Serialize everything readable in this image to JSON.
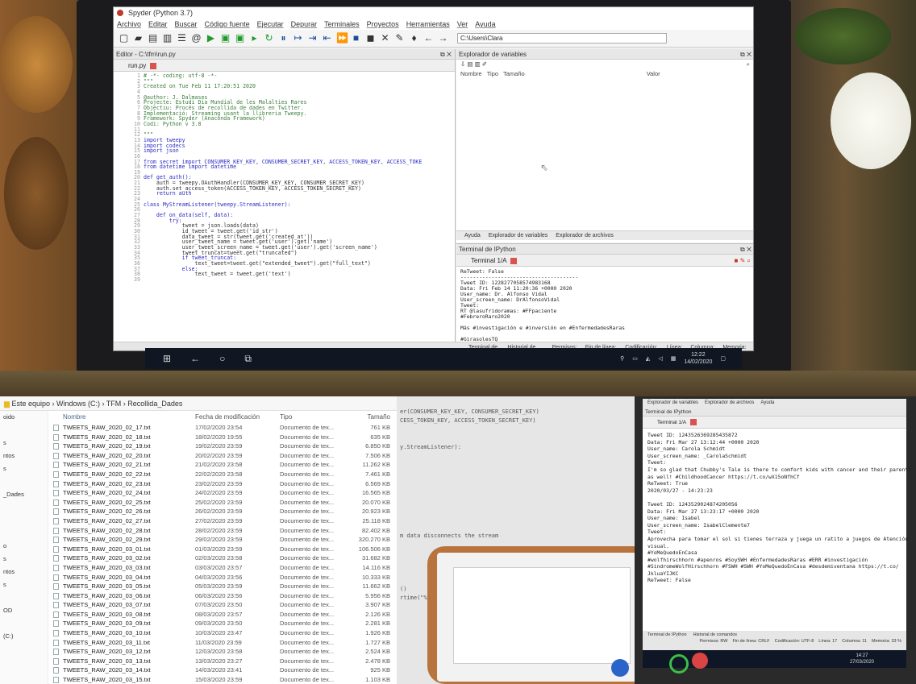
{
  "spyder": {
    "title": "Spyder (Python 3.7)",
    "menu": [
      "Archivo",
      "Editar",
      "Buscar",
      "Código fuente",
      "Ejecutar",
      "Depurar",
      "Terminales",
      "Proyectos",
      "Herramientas",
      "Ver",
      "Ayuda"
    ],
    "path": "C:\\Users\\Clara",
    "editor_header": "Editor - C:\\tfm\\run.py",
    "editor_tab": "run.py",
    "code_lines": [
      {
        "n": "1",
        "t": "# -*- coding: utf-8 -*-",
        "c": "cm"
      },
      {
        "n": "2",
        "t": "\"\"\"",
        "c": "cm"
      },
      {
        "n": "3",
        "t": "Created on Tue Feb 11 17:20:51 2020",
        "c": "cm"
      },
      {
        "n": "4",
        "t": "",
        "c": "cm"
      },
      {
        "n": "5",
        "t": "@author: J. Dalmases",
        "c": "cm"
      },
      {
        "n": "6",
        "t": "Projecte: Estudi Dia Mundial de les Malalties Rares",
        "c": "cm"
      },
      {
        "n": "7",
        "t": "Objectiu: Procés de recollida de dades en Twitter.",
        "c": "cm"
      },
      {
        "n": "8",
        "t": "Implementació: Streaming usant la llibreria Tweepy.",
        "c": "cm"
      },
      {
        "n": "9",
        "t": "Framework: Spyder (Anaconda Framework)",
        "c": "cm"
      },
      {
        "n": "10",
        "t": "Codi: Python v 3.8",
        "c": "cm"
      },
      {
        "n": "11",
        "t": "",
        "c": "cm"
      },
      {
        "n": "12",
        "t": "\"\"\"",
        "c": "cm"
      },
      {
        "n": "13",
        "t": "import tweepy",
        "c": "kw"
      },
      {
        "n": "14",
        "t": "import codecs",
        "c": "kw"
      },
      {
        "n": "15",
        "t": "import json",
        "c": "kw"
      },
      {
        "n": "16",
        "t": "",
        "c": "df"
      },
      {
        "n": "17",
        "t": "from secret import CONSUMER_KEY_KEY, CONSUMER_SECRET_KEY, ACCESS_TOKEN_KEY, ACCESS_TOKE",
        "c": "kw"
      },
      {
        "n": "18",
        "t": "from datetime import datetime",
        "c": "kw"
      },
      {
        "n": "19",
        "t": "",
        "c": "df"
      },
      {
        "n": "20",
        "t": "def get_auth():",
        "c": "kw"
      },
      {
        "n": "21",
        "t": "    auth = tweepy.OAuthHandler(CONSUMER_KEY_KEY, CONSUMER_SECRET_KEY)",
        "c": "df"
      },
      {
        "n": "22",
        "t": "    auth.set_access_token(ACCESS_TOKEN_KEY, ACCESS_TOKEN_SECRET_KEY)",
        "c": "df"
      },
      {
        "n": "23",
        "t": "    return auth",
        "c": "kw"
      },
      {
        "n": "24",
        "t": "",
        "c": "df"
      },
      {
        "n": "25",
        "t": "class MyStreamListener(tweepy.StreamListener):",
        "c": "kw"
      },
      {
        "n": "26",
        "t": "",
        "c": "df"
      },
      {
        "n": "27",
        "t": "    def on_data(self, data):",
        "c": "kw"
      },
      {
        "n": "28",
        "t": "        try:",
        "c": "kw"
      },
      {
        "n": "29",
        "t": "            tweet = json.loads(data)",
        "c": "df"
      },
      {
        "n": "30",
        "t": "            id_tweet = tweet.get('id_str')",
        "c": "df"
      },
      {
        "n": "31",
        "t": "            data_tweet = str(tweet.get('created_at'))",
        "c": "df"
      },
      {
        "n": "32",
        "t": "            user_tweet_name = tweet.get('user').get('name')",
        "c": "df"
      },
      {
        "n": "33",
        "t": "            user_tweet_screen_name = tweet.get('user').get('screen_name')",
        "c": "df"
      },
      {
        "n": "34",
        "t": "            tweet_truncat=tweet.get(\"truncated\")",
        "c": "df"
      },
      {
        "n": "35",
        "t": "            if tweet_truncat:",
        "c": "kw"
      },
      {
        "n": "36",
        "t": "                text_tweet=tweet.get(\"extended_tweet\").get(\"full_text\")",
        "c": "df"
      },
      {
        "n": "37",
        "t": "            else:",
        "c": "kw"
      },
      {
        "n": "38",
        "t": "                text_tweet = tweet.get('text')",
        "c": "df"
      },
      {
        "n": "39",
        "t": "",
        "c": "df"
      }
    ],
    "varexp_header": "Explorador de variables",
    "varexp_cols": [
      "Nombre",
      "Tipo",
      "Tamaño",
      "Valor"
    ],
    "varexp_tabs": [
      "Ayuda",
      "Explorador de variables",
      "Explorador de archivos"
    ],
    "console_header": "Terminal de IPython",
    "console_tab": "Terminal 1/A",
    "console_text": "ReTweet: False\n--------------------------------------\nTweet ID: 1228277058574983168\nData: Fri Feb 14 11:20:36 +0000 2020\nUser_name: Dr. Alfonso Vidal\nUser_screen_name: DrAlfonsoVidal\nTweet:\nRT @lasufridoramas: #FFpaciente\n#FebreroRaro2020\n\nMás #investigación e #inversión en #EnfermedadesRaras\n\n#GirasolesTQ\n#QuistosTarlov https:…\nReTweet: True",
    "console_tabs": [
      "Terminal de IPython",
      "Historial de comandos"
    ],
    "status": [
      "Permisos: RW",
      "Fin de línea: CRLF",
      "Codificación: UTF-8",
      "Línea: 1",
      "Columna: 1",
      "Memoria: 62 %"
    ],
    "clock": "12:22",
    "date": "14/02/2020"
  },
  "explorer": {
    "breadcrumb": "Este equipo  ›  Windows (C:)  ›  TFM  ›  Recollida_Dades",
    "side_items": [
      "oido",
      "",
      "s",
      "ntos",
      "s",
      "",
      "_Dades",
      "",
      "",
      "",
      "o",
      "s",
      "ntos",
      "s",
      "",
      "OD",
      "",
      "(C:)"
    ],
    "columns": [
      "Nombre",
      "Fecha de modificación",
      "Tipo",
      "Tamaño"
    ],
    "rows": [
      [
        "TWEETS_RAW_2020_02_17.txt",
        "17/02/2020 23:54",
        "Documento de tex...",
        "761 KB"
      ],
      [
        "TWEETS_RAW_2020_02_18.txt",
        "18/02/2020 19:55",
        "Documento de tex...",
        "635 KB"
      ],
      [
        "TWEETS_RAW_2020_02_19.txt",
        "19/02/2020 23:59",
        "Documento de tex...",
        "6.850 KB"
      ],
      [
        "TWEETS_RAW_2020_02_20.txt",
        "20/02/2020 23:59",
        "Documento de tex...",
        "7.506 KB"
      ],
      [
        "TWEETS_RAW_2020_02_21.txt",
        "21/02/2020 23:58",
        "Documento de tex...",
        "11.262 KB"
      ],
      [
        "TWEETS_RAW_2020_02_22.txt",
        "22/02/2020 23:58",
        "Documento de tex...",
        "7.461 KB"
      ],
      [
        "TWEETS_RAW_2020_02_23.txt",
        "23/02/2020 23:59",
        "Documento de tex...",
        "6.569 KB"
      ],
      [
        "TWEETS_RAW_2020_02_24.txt",
        "24/02/2020 23:59",
        "Documento de tex...",
        "16.565 KB"
      ],
      [
        "TWEETS_RAW_2020_02_25.txt",
        "25/02/2020 23:59",
        "Documento de tex...",
        "20.070 KB"
      ],
      [
        "TWEETS_RAW_2020_02_26.txt",
        "26/02/2020 23:59",
        "Documento de tex...",
        "20.923 KB"
      ],
      [
        "TWEETS_RAW_2020_02_27.txt",
        "27/02/2020 23:59",
        "Documento de tex...",
        "25.118 KB"
      ],
      [
        "TWEETS_RAW_2020_02_28.txt",
        "28/02/2020 23:59",
        "Documento de tex...",
        "82.402 KB"
      ],
      [
        "TWEETS_RAW_2020_02_29.txt",
        "29/02/2020 23:59",
        "Documento de tex...",
        "320.270 KB"
      ],
      [
        "TWEETS_RAW_2020_03_01.txt",
        "01/03/2020 23:59",
        "Documento de tex...",
        "106.506 KB"
      ],
      [
        "TWEETS_RAW_2020_03_02.txt",
        "02/03/2020 23:58",
        "Documento de tex...",
        "31.682 KB"
      ],
      [
        "TWEETS_RAW_2020_03_03.txt",
        "03/03/2020 23:57",
        "Documento de tex...",
        "14.116 KB"
      ],
      [
        "TWEETS_RAW_2020_03_04.txt",
        "04/03/2020 23:56",
        "Documento de tex...",
        "10.333 KB"
      ],
      [
        "TWEETS_RAW_2020_03_05.txt",
        "05/03/2020 23:59",
        "Documento de tex...",
        "11.662 KB"
      ],
      [
        "TWEETS_RAW_2020_03_06.txt",
        "06/03/2020 23:56",
        "Documento de tex...",
        "5.956 KB"
      ],
      [
        "TWEETS_RAW_2020_03_07.txt",
        "07/03/2020 23:50",
        "Documento de tex...",
        "3.907 KB"
      ],
      [
        "TWEETS_RAW_2020_03_08.txt",
        "08/03/2020 23:57",
        "Documento de tex...",
        "2.126 KB"
      ],
      [
        "TWEETS_RAW_2020_03_09.txt",
        "09/03/2020 23:50",
        "Documento de tex...",
        "2.281 KB"
      ],
      [
        "TWEETS_RAW_2020_03_10.txt",
        "10/03/2020 23:47",
        "Documento de tex...",
        "1.926 KB"
      ],
      [
        "TWEETS_RAW_2020_03_11.txt",
        "11/03/2020 23:59",
        "Documento de tex...",
        "1.727 KB"
      ],
      [
        "TWEETS_RAW_2020_03_12.txt",
        "12/03/2020 23:58",
        "Documento de tex...",
        "2.524 KB"
      ],
      [
        "TWEETS_RAW_2020_03_13.txt",
        "13/03/2020 23:27",
        "Documento de tex...",
        "2.478 KB"
      ],
      [
        "TWEETS_RAW_2020_03_14.txt",
        "14/03/2020 23:41",
        "Documento de tex...",
        "925 KB"
      ],
      [
        "TWEETS_RAW_2020_03_15.txt",
        "15/03/2020 23:59",
        "Documento de tex...",
        "1.103 KB"
      ]
    ]
  },
  "middle": {
    "code_text": "er(CONSUMER_KEY_KEY, CONSUMER_SECRET_KEY)\nCESS_TOKEN_KEY, ACCESS_TOKEN_SECRET_KEY)\n\n\ny.StreamListener):\n\n\n\n\n\n\n\n\n\nm data disconnects the stream\n\n\n\n\n\n()\nrtime(\"%Y/%m/%d - %H:%M:%S\")"
  },
  "right": {
    "tabs": [
      "Explorador de variables",
      "Explorador de archivos",
      "Ayuda"
    ],
    "header": "Terminal de IPython",
    "tab": "Terminal 1/A",
    "text": "Tweet ID: 1243526369285435872\nData: Fri Mar 27 13:12:44 +0000 2020\nUser_name: Carola Schmidt\nUser_screen_name: _CarolaSchmidt\nTweet:\nI'm so glad that Chubby's Tale is there to comfort kids with cancer and their parents\nas well! #ChildhoodCancer https://t.co/wX15oNfhCf\nReTweet: True\n2020/03/27 - 14:23:23\n\nTweet ID: 1243529024874205056\nData: Fri Mar 27 13:23:17 +0000 2020\nUser_name: Isabel\nUser_screen_name: IsabelClemente7\nTweet:\nAprovecha para tomar el sol si tienes terraza y juega un ratito a juegos de Atención\nvisual.\n#YoMeQuedoEnCasa\n#wolfhirschhorn #apenros #SoySWH #EnfermedadesRaras #ERR #investigación\n#SindromeWolfHirschhorn #FSWH #SWH #YoMeQuedoEnCasa #desdemiventana https://t.co/\nJkluaYIJKC\nReTweet: False",
    "bottom_tabs": [
      "Terminal de IPython",
      "Historial de comandos"
    ],
    "status": [
      "Permisos: RW",
      "Fin de línea: CRLF",
      "Codificación: UTF-8",
      "Línea: 17",
      "Columna: 11",
      "Memoria: 33 %"
    ],
    "clock": "14:27",
    "date": "27/03/2020"
  }
}
